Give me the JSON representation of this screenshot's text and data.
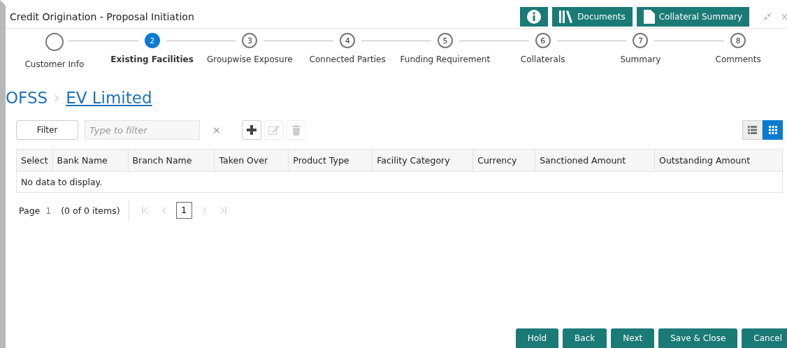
{
  "window": {
    "title": "Credit Origination - Proposal Initiation"
  },
  "header_buttons": [
    {
      "kind": "info"
    },
    {
      "kind": "documents",
      "label": "Documents"
    },
    {
      "kind": "collateral",
      "label": "Collateral Summary"
    }
  ],
  "steps": [
    {
      "label": "Customer Info",
      "selected": false
    },
    {
      "number": "2",
      "label": "Existing Facilities",
      "selected": true
    },
    {
      "number": "3",
      "label": "Groupwise Exposure",
      "selected": false
    },
    {
      "number": "4",
      "label": "Connected Parties",
      "selected": false
    },
    {
      "number": "5",
      "label": "Funding Requirement",
      "selected": false
    },
    {
      "number": "6",
      "label": "Collaterals",
      "selected": false
    },
    {
      "number": "7",
      "label": "Summary",
      "selected": false
    },
    {
      "number": "8",
      "label": "Comments",
      "selected": false
    }
  ],
  "breadcrumb": [
    {
      "label": "OFSS",
      "link": false
    },
    {
      "label": "EV Limited",
      "link": true
    }
  ],
  "toolbar": {
    "filter_button": "Filter",
    "filter_placeholder": "Type to filter",
    "clear": "×",
    "actions": [
      {
        "kind": "add",
        "disabled": false
      },
      {
        "kind": "edit",
        "disabled": true
      },
      {
        "kind": "delete",
        "disabled": true
      }
    ],
    "views": [
      {
        "kind": "list",
        "selected": false
      },
      {
        "kind": "grid",
        "selected": true
      }
    ]
  },
  "table": {
    "columns": [
      "Select",
      "Bank Name",
      "Branch Name",
      "Taken Over",
      "Product Type",
      "Facility Category",
      "Currency",
      "Sanctioned Amount",
      "Outstanding Amount"
    ],
    "empty_message": "No data to display."
  },
  "pagination": {
    "label": "Page",
    "page": "1",
    "summary": "(0 of 0 items)",
    "current": "1"
  },
  "footer_buttons": [
    "Hold",
    "Back",
    "Next",
    "Save & Close",
    "Cancel"
  ]
}
